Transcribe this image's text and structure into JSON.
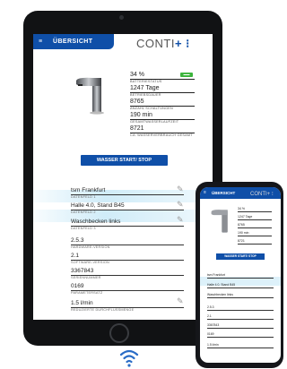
{
  "header": {
    "tab_label": "ÜBERSICHT",
    "menu_glyph": "≡",
    "logo_text": "CONTI",
    "logo_plus": "+ ⁝"
  },
  "status": {
    "battery_value": "34 %",
    "battery_label": "BATTERIESTATUS",
    "battery_badge": "▬▬",
    "runtime_value": "1247 Tage",
    "runtime_label": "BETRIEBSDAUER",
    "switchings_value": "8765",
    "switchings_label": "ANZAHL SCHALTUNGEN",
    "duration_value": "190 min",
    "duration_label": "GESAMTWASSERLAUFZEIT",
    "consumption_value": "8721",
    "consumption_label": "CA. WASSERVERBRAUCH GESAMT"
  },
  "water_button": "WASSER START/ STOP",
  "fields": [
    {
      "value": "tsm Frankfurt",
      "label": "DATENFELD 1"
    },
    {
      "value": "Halle 4.0, Stand B45",
      "label": "DATENFELD 2"
    },
    {
      "value": "Waschbecken links",
      "label": "DATENFELD 3"
    },
    {
      "value": "2.5.3",
      "label": "HARDWARE-VERSION"
    },
    {
      "value": "2.1",
      "label": "SOFTWARE-VERSION"
    },
    {
      "value": "3367843",
      "label": "SERIENNUMMER"
    },
    {
      "value": "0169",
      "label": "PARAMETERSATZ"
    },
    {
      "value": "1.5 l/min",
      "label": "REDUZIERTE DURCHFLUSSMENGE"
    }
  ],
  "phone": {
    "tab_label": "ÜBERSICHT",
    "logo_text": "CONTI+ ⁝",
    "stats": [
      "34 %",
      "1247 Tage",
      "8765",
      "190 min",
      "8721"
    ],
    "water_button": "WASSER START/ STOP",
    "fields": [
      "tsm Frankfurt",
      "Halle 4.0, Stand B45",
      "Waschbecken links",
      "2.5.3",
      "2.1",
      "3367843",
      "0169",
      "1.5 l/min"
    ]
  },
  "icons": {
    "pencil": "✎",
    "signal": "bluetooth-signal-icon"
  },
  "colors": {
    "brand_blue": "#0f4fa8",
    "battery_green": "#3cb43c"
  }
}
